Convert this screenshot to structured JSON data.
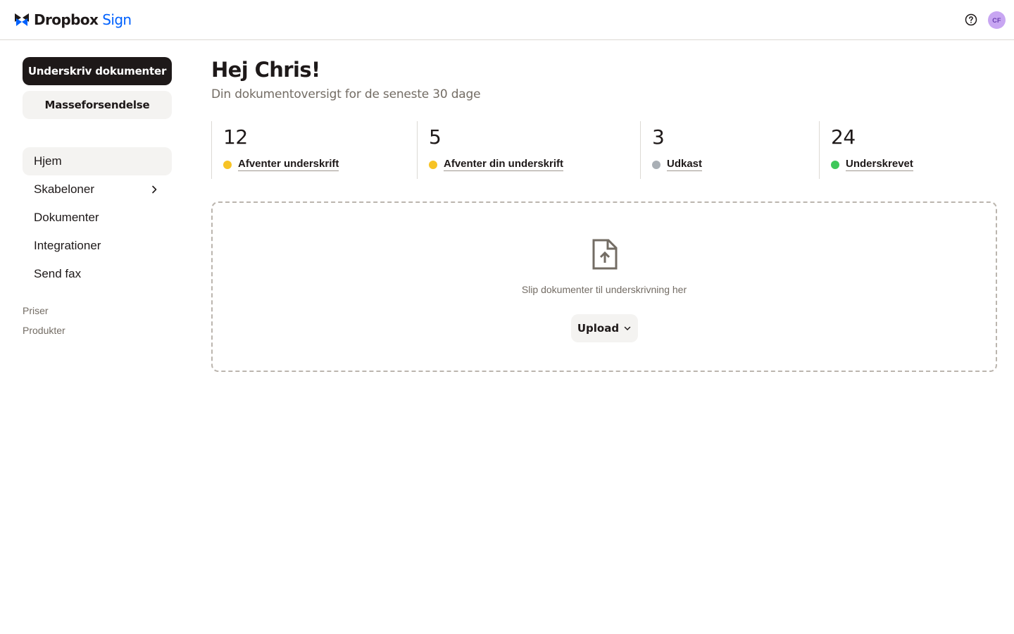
{
  "brand": {
    "name": "Dropbox",
    "product": "Sign"
  },
  "header": {
    "help_icon": "help-circle-icon",
    "avatar_initials": "CF"
  },
  "sidebar": {
    "primary_button": "Underskriv dokumenter",
    "secondary_button": "Masseforsendelse",
    "nav": [
      {
        "label": "Hjem",
        "active": true
      },
      {
        "label": "Skabeloner",
        "has_submenu": true
      },
      {
        "label": "Dokumenter"
      },
      {
        "label": "Integrationer"
      },
      {
        "label": "Send fax"
      }
    ],
    "links": [
      "Priser",
      "Produkter"
    ]
  },
  "main": {
    "greeting": "Hej Chris!",
    "subtitle": "Din dokumentoversigt for de seneste 30 dage",
    "stats": [
      {
        "count": "12",
        "label": "Afventer underskrift",
        "color": "#f7c325"
      },
      {
        "count": "5",
        "label": "Afventer din underskrift",
        "color": "#f7c325"
      },
      {
        "count": "3",
        "label": "Udkast",
        "color": "#a9afb5"
      },
      {
        "count": "24",
        "label": "Underskrevet",
        "color": "#3ec75a"
      }
    ],
    "dropzone": {
      "icon": "file-upload-icon",
      "text": "Slip dokumenter til underskrivning her",
      "upload_label": "Upload"
    }
  },
  "colors": {
    "accent": "#0061fe",
    "primary_button": "#1e1919",
    "muted_text": "#736c64",
    "avatar_bg": "#c8a6f2"
  }
}
